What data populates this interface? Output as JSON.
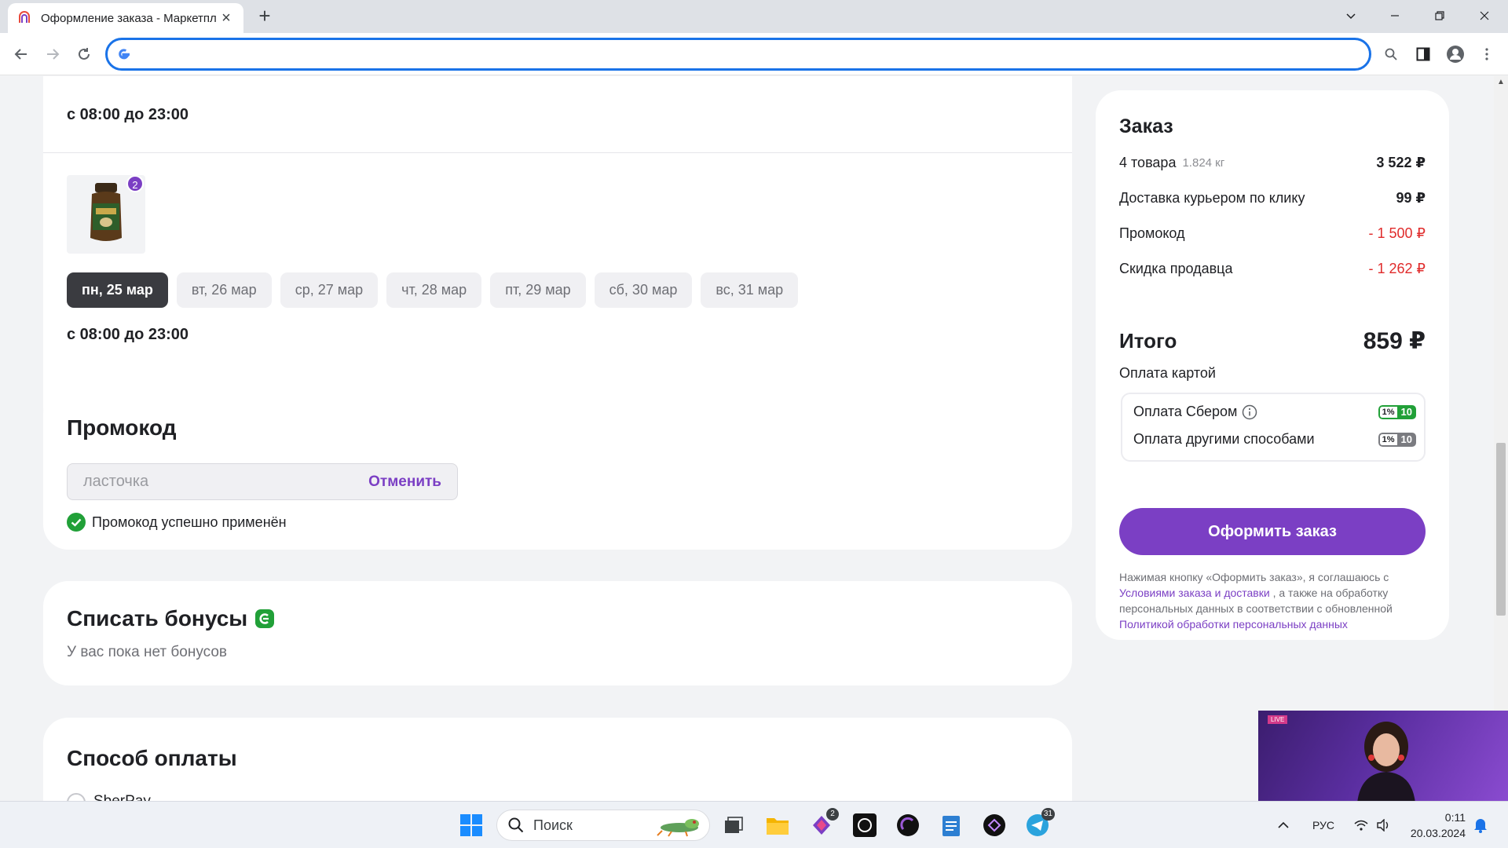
{
  "browser": {
    "tab_title": "Оформление заказа - Маркетплейс",
    "url": ""
  },
  "delivery": {
    "time_top": "с 08:00 до 23:00",
    "item_qty": "2",
    "dates": [
      "пн, 25 мар",
      "вт, 26 мар",
      "ср, 27 мар",
      "чт, 28 мар",
      "пт, 29 мар",
      "сб, 30 мар",
      "вс, 31 мар"
    ],
    "active_date_index": 0,
    "time_bottom": "с 08:00 до 23:00"
  },
  "promo": {
    "title": "Промокод",
    "value": "ласточка",
    "cancel_label": "Отменить",
    "success_text": "Промокод успешно применён"
  },
  "bonus": {
    "title": "Списать бонусы",
    "subtitle": "У вас пока нет бонусов"
  },
  "payment": {
    "title": "Способ оплаты",
    "first_option_label": "SberPay"
  },
  "order": {
    "title": "Заказ",
    "items_label": "4 товара",
    "items_weight": "1.824 кг",
    "items_value": "3 522 ₽",
    "delivery_label": "Доставка курьером по клику",
    "delivery_value": "99 ₽",
    "promo_label": "Промокод",
    "promo_value": "- 1 500 ₽",
    "seller_discount_label": "Скидка продавца",
    "seller_discount_value": "- 1 262 ₽",
    "total_label": "Итого",
    "total_value": "859 ₽",
    "pay_method": "Оплата картой",
    "pay_sber_label": "Оплата Сбером",
    "pay_other_label": "Оплата другими способами",
    "cashback_pct": "1%",
    "cashback_amount": "10",
    "checkout_label": "Оформить заказ",
    "legal_prefix": "Нажимая кнопку «Оформить заказ», я соглашаюсь с",
    "legal_link1": "Условиями заказа и доставки",
    "legal_middle": ", а также на обработку персональных данных в соответствии с обновленной",
    "legal_link2": "Политикой обработки персональных данных"
  },
  "video": {
    "badge": "LIVE"
  },
  "taskbar": {
    "search_placeholder": "Поиск",
    "badge_app1": "2",
    "badge_telegram": "31",
    "lang": "РУС",
    "time": "0:11",
    "date": "20.03.2024"
  },
  "colors": {
    "accent": "#7b3fc4",
    "red": "#e02b2b",
    "green": "#21a038"
  }
}
